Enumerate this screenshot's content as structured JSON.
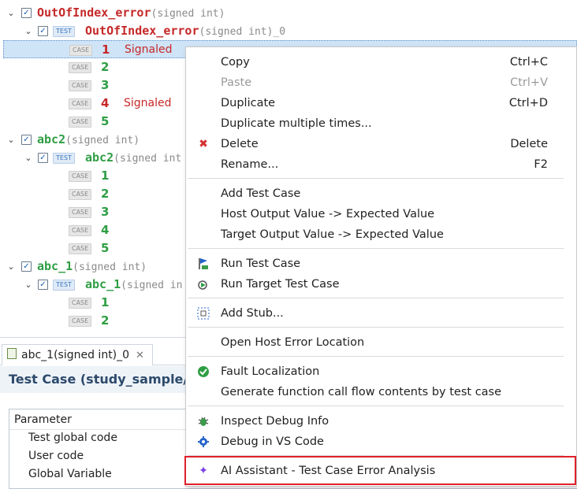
{
  "tree": {
    "groups": [
      {
        "name": "OutOfIndex_error",
        "sig": "(signed int)",
        "test_name": "OutOfIndex_error",
        "test_sig": "(signed int)_0",
        "cases": [
          {
            "n": "1",
            "status": "Signaled"
          },
          {
            "n": "2",
            "status": ""
          },
          {
            "n": "3",
            "status": ""
          },
          {
            "n": "4",
            "status": "Signaled"
          },
          {
            "n": "5",
            "status": ""
          }
        ]
      },
      {
        "name": "abc2",
        "sig": "(signed int)",
        "test_name": "abc2",
        "test_sig": "(signed int",
        "cases": [
          {
            "n": "1"
          },
          {
            "n": "2"
          },
          {
            "n": "3"
          },
          {
            "n": "4"
          },
          {
            "n": "5"
          }
        ]
      },
      {
        "name": "abc_1",
        "sig": "(signed int)",
        "test_name": "abc_1",
        "test_sig": "(signed in",
        "cases": [
          {
            "n": "1"
          },
          {
            "n": "2"
          }
        ]
      }
    ],
    "test_badge": "TEST",
    "case_badge": "CASE"
  },
  "editor": {
    "tab_label": "abc_1(signed int)_0",
    "form_title": "Test Case (study_sample/ab",
    "params": [
      "Parameter",
      "Test global code",
      "User code",
      "Global Variable"
    ]
  },
  "context_menu": {
    "items": [
      {
        "label": "Copy",
        "shortcut": "Ctrl+C"
      },
      {
        "label": "Paste",
        "shortcut": "Ctrl+V"
      },
      {
        "label": "Duplicate",
        "shortcut": "Ctrl+D"
      },
      {
        "label": "Duplicate multiple times...",
        "shortcut": ""
      },
      {
        "label": "Delete",
        "shortcut": "Delete",
        "icon": "delete-x-icon"
      },
      {
        "label": "Rename...",
        "shortcut": "F2"
      },
      {
        "label": "Add Test Case"
      },
      {
        "label": "Host Output Value -> Expected Value"
      },
      {
        "label": "Target Output Value -> Expected Value"
      },
      {
        "label": "Run Test Case",
        "icon": "run-flag-icon"
      },
      {
        "label": "Run Target Test Case",
        "icon": "run-target-icon"
      },
      {
        "label": "Add Stub...",
        "icon": "stub-icon"
      },
      {
        "label": "Open Host Error Location"
      },
      {
        "label": "Fault Localization",
        "icon": "fault-localization-icon"
      },
      {
        "label": "Generate function call flow contents by test case"
      },
      {
        "label": "Inspect Debug Info",
        "icon": "bug-icon"
      },
      {
        "label": "Debug in VS Code",
        "icon": "debug-gear-icon"
      },
      {
        "label": "AI Assistant - Test Case Error Analysis",
        "icon": "sparkle-icon"
      }
    ]
  },
  "colors": {
    "accent_red": "#c62828",
    "pass_green": "#2e9e44",
    "highlight_border": "#e0202a",
    "selection": "#cfe4f7"
  }
}
